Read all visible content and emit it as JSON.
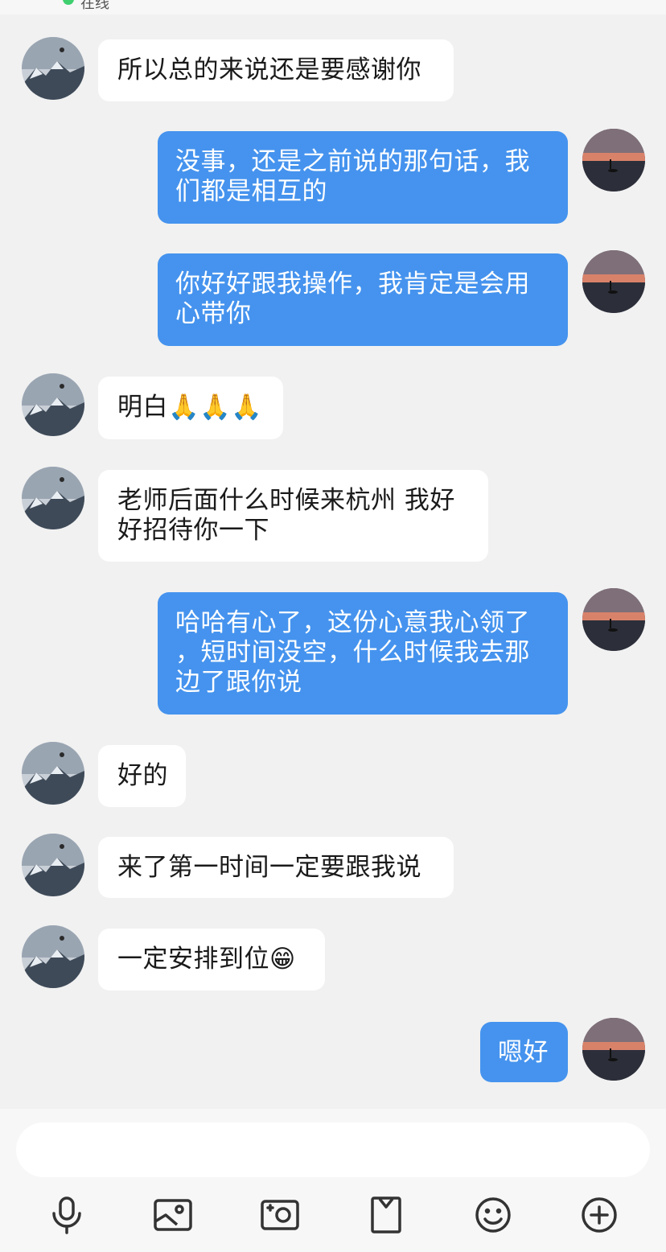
{
  "status_bar": {
    "status_text": "在线"
  },
  "messages": [
    {
      "side": "incoming",
      "text": "所以总的来说还是要感谢你"
    },
    {
      "side": "outgoing",
      "text": "没事，还是之前说的那句话，我\n们都是相互的"
    },
    {
      "side": "outgoing",
      "text": "你好好跟我操作，我肯定是会用\n心带你"
    },
    {
      "side": "incoming",
      "text": "明白🙏🙏🙏"
    },
    {
      "side": "incoming",
      "text": "老师后面什么时候来杭州 我好\n好招待你一下"
    },
    {
      "side": "outgoing",
      "text": "哈哈有心了，这份心意我心领了\n，短时间没空，什么时候我去那\n边了跟你说"
    },
    {
      "side": "incoming",
      "text": "好的"
    },
    {
      "side": "incoming",
      "text": "来了第一时间一定要跟我说"
    },
    {
      "side": "incoming",
      "text": "一定安排到位😁"
    },
    {
      "side": "outgoing",
      "text": "嗯好"
    }
  ],
  "toolbar": {
    "icons": [
      "microphone-icon",
      "image-icon",
      "camera-icon",
      "file-icon",
      "emoji-icon",
      "plus-icon"
    ]
  },
  "colors": {
    "background": "#f1f1f1",
    "incoming_bubble": "#ffffff",
    "outgoing_bubble": "#4593ee",
    "online_dot": "#3fcf6f"
  }
}
